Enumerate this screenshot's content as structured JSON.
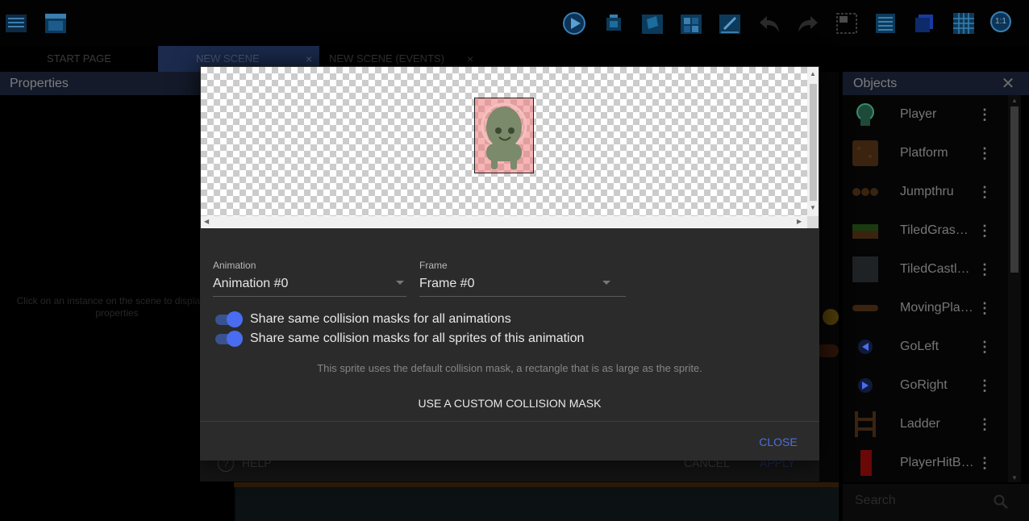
{
  "toolbar": {
    "icons": [
      "project-manager-icon",
      "scene-window-icon",
      "preview-play-icon",
      "network-preview-icon",
      "objects-panel-icon",
      "object-groups-icon",
      "properties-icon",
      "undo-icon",
      "redo-icon",
      "instances-list-icon",
      "layers-icon",
      "window-mask-icon",
      "grid-icon",
      "zoom-reset-icon"
    ],
    "zoom_label": "1:1"
  },
  "tabs": [
    {
      "label": "START PAGE"
    },
    {
      "label": "NEW SCENE",
      "close": "×"
    },
    {
      "label": "NEW SCENE (EVENTS)",
      "close": "×"
    }
  ],
  "properties": {
    "title": "Properties",
    "hint": "Click on an instance on the scene to display its properties"
  },
  "objects": {
    "title": "Objects",
    "close": "✕",
    "items": [
      {
        "name": "Player",
        "icon": "player-thumb",
        "menu": "⋮"
      },
      {
        "name": "Platform",
        "icon": "platform-thumb",
        "menu": "⋮"
      },
      {
        "name": "Jumpthru",
        "icon": "jumpthru-thumb",
        "menu": "⋮"
      },
      {
        "name": "TiledGrassPlatform",
        "icon": "tiled-grass-thumb",
        "menu": "⋮"
      },
      {
        "name": "TiledCastlePlatform",
        "icon": "tiled-castle-thumb",
        "menu": "⋮"
      },
      {
        "name": "MovingPlatform",
        "icon": "moving-platform-thumb",
        "menu": "⋮"
      },
      {
        "name": "GoLeft",
        "icon": "go-left-thumb",
        "menu": "⋮"
      },
      {
        "name": "GoRight",
        "icon": "go-right-thumb",
        "menu": "⋮"
      },
      {
        "name": "Ladder",
        "icon": "ladder-thumb",
        "menu": "⋮"
      },
      {
        "name": "PlayerHitBox",
        "icon": "player-hitbox-thumb",
        "menu": "⋮"
      }
    ],
    "search_placeholder": "Search"
  },
  "dialog": {
    "animation": {
      "label": "Animation",
      "value": "Animation #0"
    },
    "frame": {
      "label": "Frame",
      "value": "Frame #0"
    },
    "toggle_all_animations": {
      "label": "Share same collision masks for all animations",
      "on": true
    },
    "toggle_all_sprites": {
      "label": "Share same collision masks for all sprites of this animation",
      "on": true
    },
    "info": "This sprite uses the default collision mask, a rectangle that is as large as the sprite.",
    "custom_button": "USE A CUSTOM COLLISION MASK",
    "close_button": "CLOSE"
  },
  "underlying_dialog": {
    "help": "HELP",
    "help_icon": "?",
    "cancel": "CANCEL",
    "apply": "APPLY"
  },
  "colors": {
    "accent": "#4a6cf0",
    "panel_header": "#141a2a",
    "dialog_bg": "#2b2b2b"
  }
}
